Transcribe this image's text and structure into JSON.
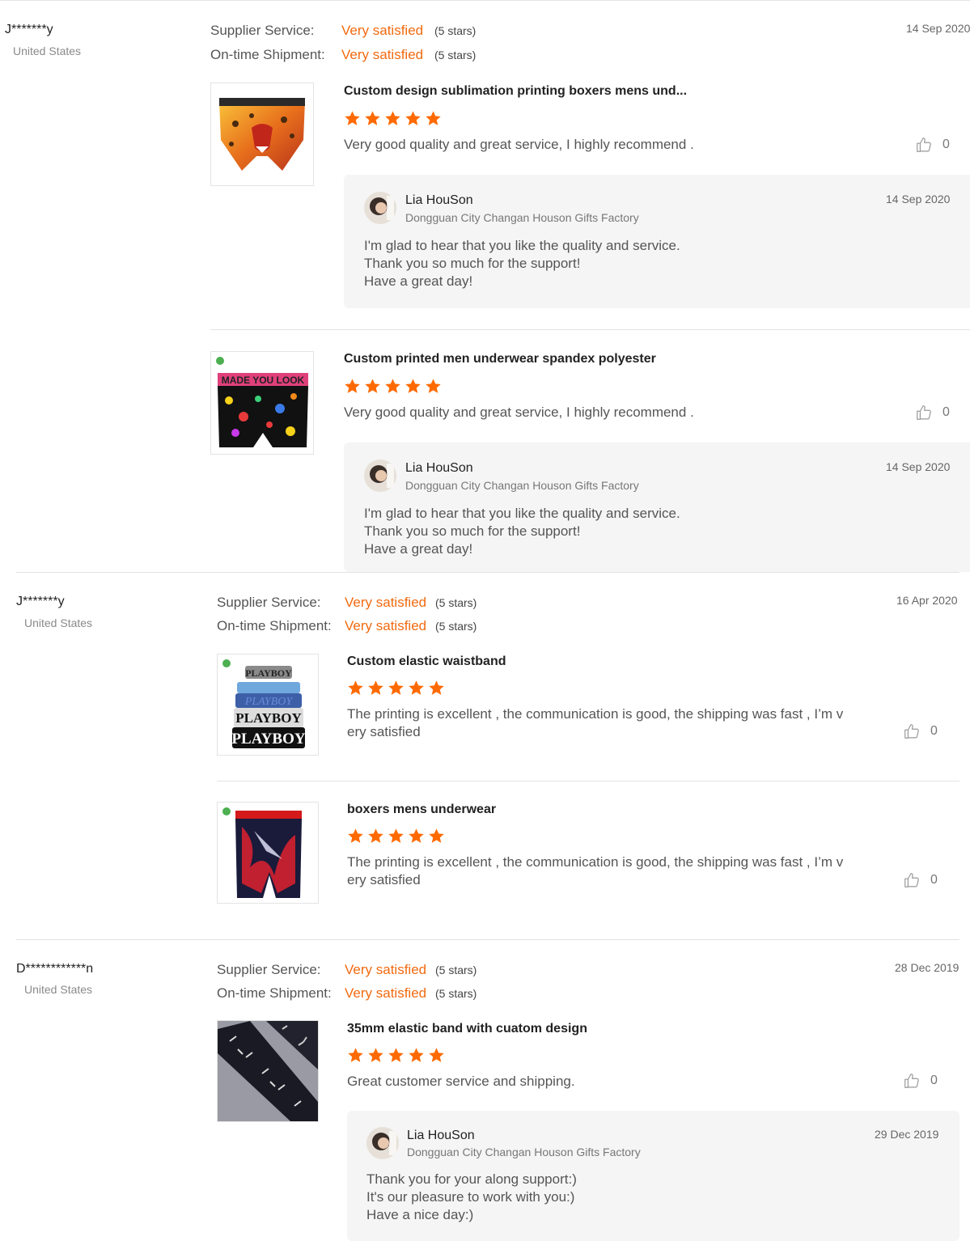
{
  "colors": {
    "accent": "#f26a10",
    "star": "#ff6a00"
  },
  "labels": {
    "supplier_service": "Supplier Service:",
    "ontime_shipment": "On-time Shipment:"
  },
  "reviews": [
    {
      "buyer": "J*******y",
      "country": "United States",
      "supplier_rating": "Very satisfied",
      "supplier_stars": "(5 stars)",
      "shipment_rating": "Very satisfied",
      "shipment_stars": "(5 stars)",
      "date": "14 Sep 2020",
      "items": [
        {
          "title": "Custom design sublimation printing boxers mens und...",
          "rating": 5,
          "text": "Very good quality and great service, I highly recommend .",
          "likes": "0",
          "reply": {
            "name": "Lia HouSon",
            "company": "Dongguan City Changan Houson Gifts Factory",
            "date": "14 Sep 2020",
            "lines": [
              "I'm glad to hear that you like the quality and service.",
              "Thank you so much for the support!",
              "Have a great day!"
            ]
          }
        },
        {
          "title": "Custom printed men underwear spandex polyester",
          "rating": 5,
          "text": "Very good quality and great service, I highly recommend .",
          "likes": "0",
          "reply": {
            "name": "Lia HouSon",
            "company": "Dongguan City Changan Houson Gifts Factory",
            "date": "14 Sep 2020",
            "lines": [
              "I'm glad to hear that you like the quality and service.",
              "Thank you so much for the support!",
              "Have a great day!"
            ]
          }
        }
      ]
    },
    {
      "buyer": "J*******y",
      "country": "United States",
      "supplier_rating": "Very satisfied",
      "supplier_stars": "(5 stars)",
      "shipment_rating": "Very satisfied",
      "shipment_stars": "(5 stars)",
      "date": "16 Apr 2020",
      "items": [
        {
          "title": "Custom elastic waistband",
          "rating": 5,
          "text_lines": [
            "The printing is excellent , the communication is good, the shipping was fast , I’m v",
            "ery satisfied"
          ],
          "likes": "0",
          "image_text": [
            "PLAYBOY",
            "PLAYBOY",
            "PLAYBOY",
            "PLAYBOY"
          ]
        },
        {
          "title": "boxers mens underwear",
          "rating": 5,
          "text_lines": [
            "The printing is excellent , the communication is good, the shipping was fast , I’m v",
            "ery satisfied"
          ],
          "likes": "0"
        }
      ]
    },
    {
      "buyer": "D************n",
      "country": "United States",
      "supplier_rating": "Very satisfied",
      "supplier_stars": "(5 stars)",
      "shipment_rating": "Very satisfied",
      "shipment_stars": "(5 stars)",
      "date": "28 Dec 2019",
      "items": [
        {
          "title": "35mm elastic band with cuatom design",
          "rating": 5,
          "text": "Great customer service and shipping.",
          "likes": "0",
          "reply": {
            "name": "Lia HouSon",
            "company": "Dongguan City Changan Houson Gifts Factory",
            "date": "29 Dec 2019",
            "lines": [
              "Thank you for your along support:)",
              "It's our pleasure to work with you:)",
              "Have a nice day:)"
            ]
          }
        }
      ]
    }
  ]
}
